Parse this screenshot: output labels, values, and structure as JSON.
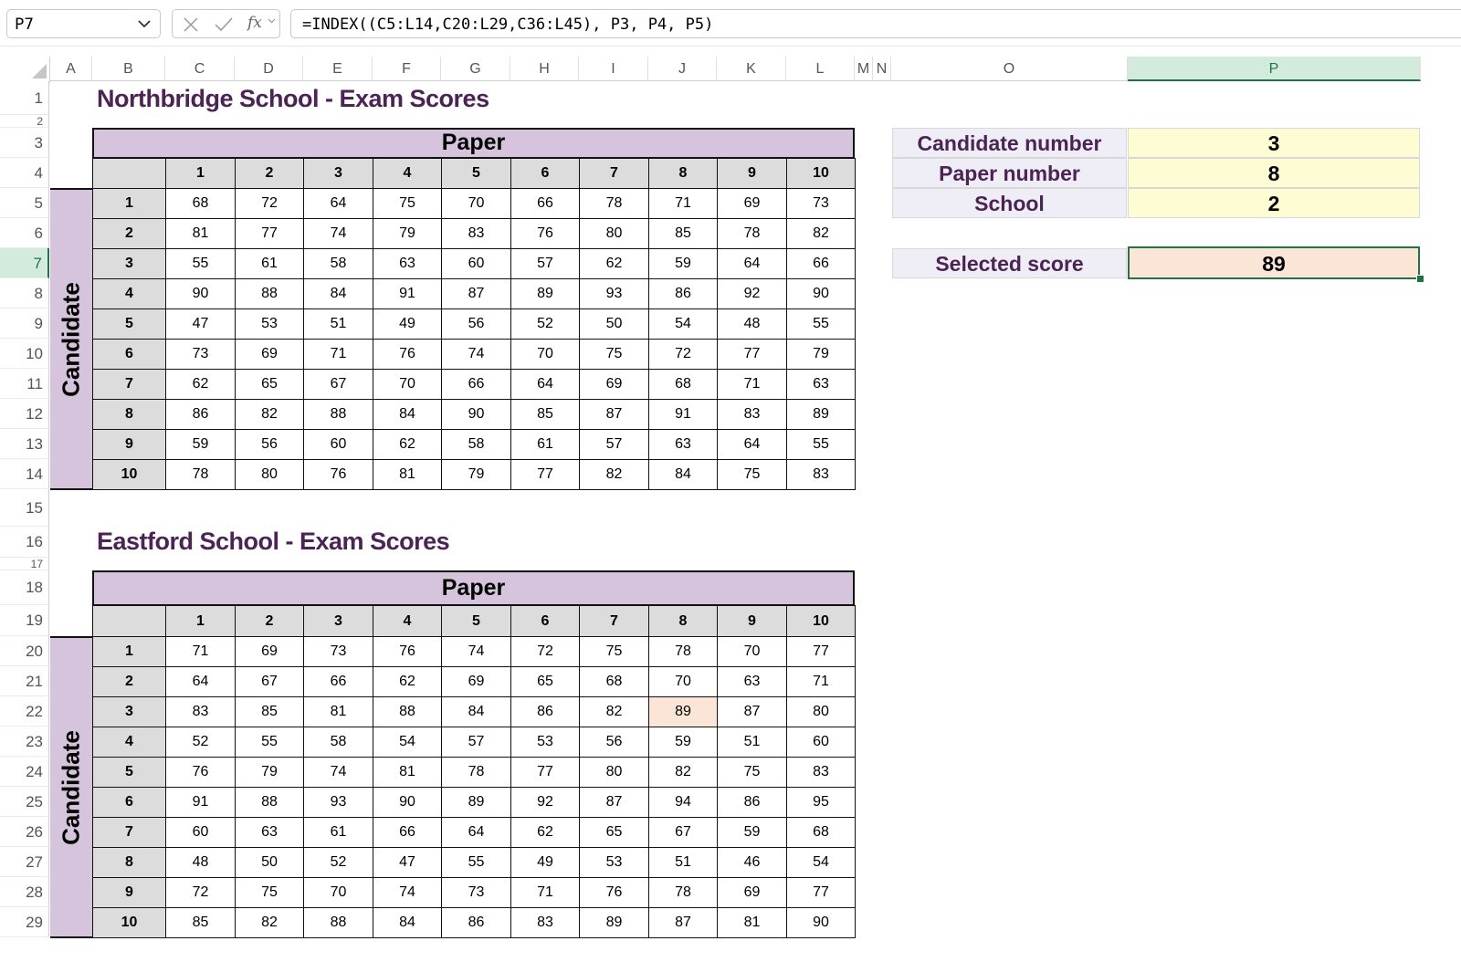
{
  "formula_bar": {
    "name_box": "P7",
    "formula": "=INDEX((C5:L14,C20:L29,C36:L45), P3, P4, P5)",
    "cancel_icon": "close-icon",
    "enter_icon": "check-icon",
    "function_label": "fx"
  },
  "columns": [
    "A",
    "B",
    "C",
    "D",
    "E",
    "F",
    "G",
    "H",
    "I",
    "J",
    "K",
    "L",
    "M",
    "N",
    "O",
    "P"
  ],
  "selected_column": "P",
  "rows": [
    "1",
    "2",
    "3",
    "4",
    "5",
    "6",
    "7",
    "8",
    "9",
    "10",
    "11",
    "12",
    "13",
    "14",
    "15",
    "16",
    "17",
    "18",
    "19",
    "20",
    "21",
    "22",
    "23",
    "24",
    "25",
    "26",
    "27",
    "28",
    "29"
  ],
  "selected_row": "7",
  "tables": [
    {
      "title": "Northbridge School - Exam Scores",
      "paper_label": "Paper",
      "candidate_label": "Candidate",
      "paper_numbers": [
        "1",
        "2",
        "3",
        "4",
        "5",
        "6",
        "7",
        "8",
        "9",
        "10"
      ],
      "candidate_numbers": [
        "1",
        "2",
        "3",
        "4",
        "5",
        "6",
        "7",
        "8",
        "9",
        "10"
      ],
      "scores": [
        [
          68,
          72,
          64,
          75,
          70,
          66,
          78,
          71,
          69,
          73
        ],
        [
          81,
          77,
          74,
          79,
          83,
          76,
          80,
          85,
          78,
          82
        ],
        [
          55,
          61,
          58,
          63,
          60,
          57,
          62,
          59,
          64,
          66
        ],
        [
          90,
          88,
          84,
          91,
          87,
          89,
          93,
          86,
          92,
          90
        ],
        [
          47,
          53,
          51,
          49,
          56,
          52,
          50,
          54,
          48,
          55
        ],
        [
          73,
          69,
          71,
          76,
          74,
          70,
          75,
          72,
          77,
          79
        ],
        [
          62,
          65,
          67,
          70,
          66,
          64,
          69,
          68,
          71,
          63
        ],
        [
          86,
          82,
          88,
          84,
          90,
          85,
          87,
          91,
          83,
          89
        ],
        [
          59,
          56,
          60,
          62,
          58,
          61,
          57,
          63,
          64,
          55
        ],
        [
          78,
          80,
          76,
          81,
          79,
          77,
          82,
          84,
          75,
          83
        ]
      ]
    },
    {
      "title": "Eastford School - Exam Scores",
      "paper_label": "Paper",
      "candidate_label": "Candidate",
      "paper_numbers": [
        "1",
        "2",
        "3",
        "4",
        "5",
        "6",
        "7",
        "8",
        "9",
        "10"
      ],
      "candidate_numbers": [
        "1",
        "2",
        "3",
        "4",
        "5",
        "6",
        "7",
        "8",
        "9",
        "10"
      ],
      "scores": [
        [
          71,
          69,
          73,
          76,
          74,
          72,
          75,
          78,
          70,
          77
        ],
        [
          64,
          67,
          66,
          62,
          69,
          65,
          68,
          70,
          63,
          71
        ],
        [
          83,
          85,
          81,
          88,
          84,
          86,
          82,
          89,
          87,
          80
        ],
        [
          52,
          55,
          58,
          54,
          57,
          53,
          56,
          59,
          51,
          60
        ],
        [
          76,
          79,
          74,
          81,
          78,
          77,
          80,
          82,
          75,
          83
        ],
        [
          91,
          88,
          93,
          90,
          89,
          92,
          87,
          94,
          86,
          95
        ],
        [
          60,
          63,
          61,
          66,
          64,
          62,
          65,
          67,
          59,
          68
        ],
        [
          48,
          50,
          52,
          47,
          55,
          49,
          53,
          51,
          46,
          54
        ],
        [
          72,
          75,
          70,
          74,
          73,
          71,
          76,
          78,
          69,
          77
        ],
        [
          85,
          82,
          88,
          84,
          86,
          83,
          89,
          87,
          81,
          90
        ]
      ]
    }
  ],
  "lookup": {
    "candidate_label": "Candidate number",
    "candidate_value": "3",
    "paper_label": "Paper number",
    "paper_value": "8",
    "school_label": "School",
    "school_value": "2",
    "result_label": "Selected score",
    "result_value": "89"
  },
  "colors": {
    "title": "#4b2455",
    "header_purple": "#d6c3dc",
    "input_yellow": "#fdfcd2",
    "result_peach": "#fbe5d6",
    "label_lavender": "#efedf5",
    "selection_green": "#217346"
  }
}
